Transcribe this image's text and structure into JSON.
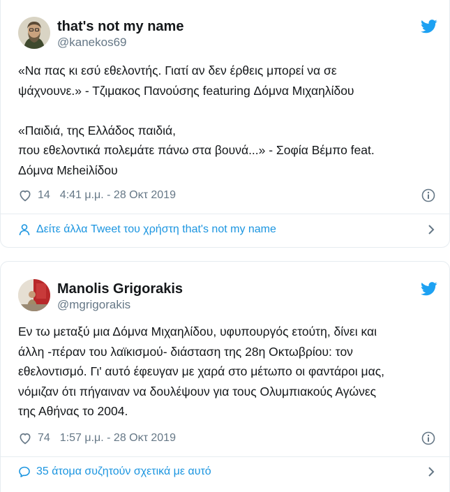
{
  "tweets": [
    {
      "display_name": "that's not my name",
      "handle": "@kanekos69",
      "text": "«Να πας κι εσύ εθελοντής. Γιατί αν δεν έρθεις μπορεί να σε\nψάχνουνε.» - Τζιμακος Πανούσης featuring Δόμνα Μιχαηλίδου\n\n«Παιδιά, της Ελλάδος παιδιά,\nπου εθελοντικά πολεμάτε πάνω στα βουνά...» - Σοφία Βέμπο feat.\nΔόμνα Μεheiλίδου",
      "likes": "14",
      "timestamp": "4:41 μ.μ. - 28 Οκτ 2019",
      "footer": "Δείτε άλλα Tweet του χρήστη that's not my name",
      "footer_icon": "person-icon"
    },
    {
      "display_name": "Manolis Grigorakis",
      "handle": "@mgrigorakis",
      "text": "Εν τω μεταξύ μια Δόμνα Μιχαηλίδου, υφυπουργός ετούτη, δίνει και\nάλλη -πέραν του λαϊκισμού- διάσταση της 28η Οκτωβρίου: τον\nεθελοντισμό. Γι' αυτό έφευγαν με χαρά στο μέτωπο οι φαντάροι μας,\nνόμιζαν ότι πήγαιναν να δουλέψουν για τους Ολυμπιακούς Αγώνες\nτης Αθήνας το 2004.",
      "likes": "74",
      "timestamp": "1:57 μ.μ. - 28 Οκτ 2019",
      "footer": "35 άτομα συζητούν σχετικά με αυτό",
      "footer_icon": "speech-bubble-icon"
    }
  ],
  "colors": {
    "twitter_blue": "#1da1f2",
    "link_blue": "#1b95e0",
    "secondary_text": "#657786",
    "border": "#e6ecf0"
  }
}
